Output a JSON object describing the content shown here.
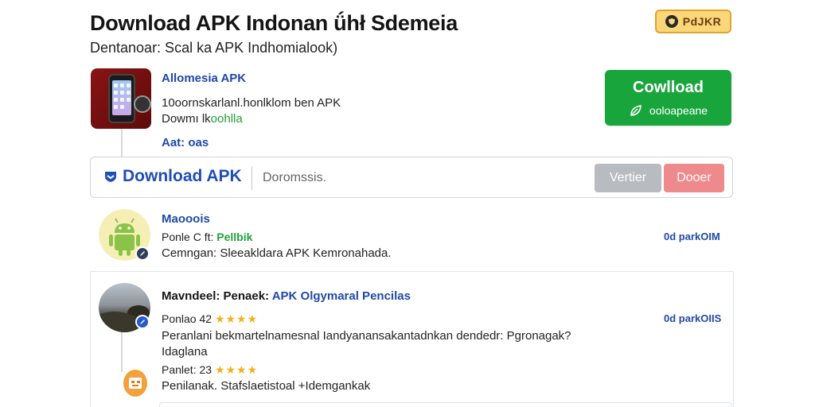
{
  "header": {
    "title": "Download APK Indonan ǘhł Sdemeia",
    "subtitle": "Dentanoar: Scal ka APK Indhomialook)",
    "badge_label": "PdJKR",
    "badge_icon": "shield-icon"
  },
  "app": {
    "name": "Allomesia APK",
    "description_line1": "10oornskarlanl.honlklom ben APK",
    "description_line2_prefix": "Dowmı lk",
    "description_line2_highlight": "oohlla",
    "meta": "Aat: oas",
    "download_button": {
      "title": "Cowlload",
      "subtitle": "ooloapeane",
      "icon": "leaf-icon",
      "color": "#18a53c"
    }
  },
  "search": {
    "brand_label": "Download APK",
    "brand_icon": "download-shield-icon",
    "placeholder": "Doromssis.",
    "button_gray": "Vertier",
    "button_pink": "Dooer"
  },
  "items": [
    {
      "title": "Maooois",
      "line1_prefix": "Ponle C ft:",
      "line1_highlight": "Pellbik",
      "line2": "Cemngan: Sleeakldara APK Kemronahada.",
      "right": "0d parkOIM",
      "avatar_icon": "android-icon"
    },
    {
      "title_dark": "Mavndeel: Penaek:",
      "title_blue": "APK Olgymaral Pencilas",
      "line1_prefix": "Ponlao 42",
      "stars": "★★★★",
      "line2": "Peranlani bekmartelnamesnal Iandyanansakantadnkan dendedr: Pgronagak?",
      "line3": "Idaglana",
      "right": "0d parkOIIS",
      "avatar_icon": "landscape-avatar-icon"
    },
    {
      "line1_prefix": "Panlet: 23",
      "stars": "★★★★",
      "line2": "Penilanak. Stafslaetistoal +Idemgankak",
      "avatar_icon": "robot-avatar-icon"
    }
  ],
  "colors": {
    "accent_blue": "#1f49a8",
    "green": "#18a53c",
    "badge_bg": "#fbd77a",
    "star": "#f2b01e"
  }
}
